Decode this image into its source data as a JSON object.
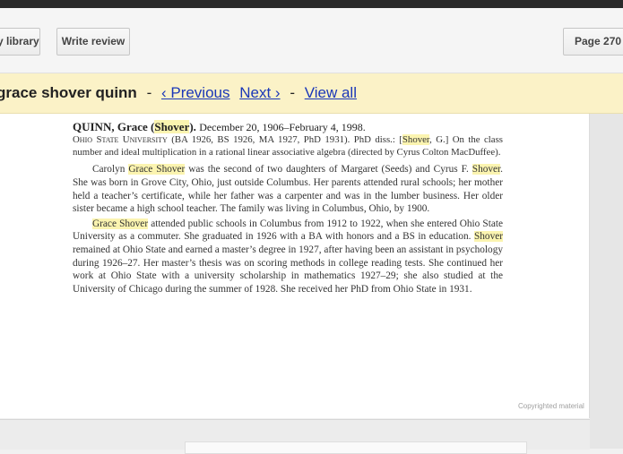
{
  "toolbar": {
    "library_label": "y library",
    "review_label": "Write review",
    "page_label": "Page 270"
  },
  "search": {
    "query": "grace shover quinn",
    "previous": "‹ Previous",
    "next": "Next ›",
    "view_all": "View all",
    "sep": "-"
  },
  "entry": {
    "name": "QUINN, Grace (",
    "name_hl": "Shover",
    "name_end": ").",
    "dates": "December 20, 1906–February 4, 1998.",
    "school": "Ohio State University",
    "degrees": "(BA 1926, BS 1926, MA 1927, PhD 1931). PhD diss.: [",
    "diss_hl": "Shover",
    "diss_rest": ", G.] On the class number and ideal multiplication in a rational linear associative algebra (directed by Cyrus Colton MacDuffee).",
    "p1_a": "Carolyn ",
    "p1_hl1": "Grace Shover",
    "p1_b": " was the second of two daughters of Margaret (Seeds) and Cyrus F. ",
    "p1_hl2": "Shover",
    "p1_c": ". She was born in Grove City, Ohio, just outside Columbus. Her parents attended rural schools; her mother held a teacher’s certificate, while her father was a carpenter and was in the lumber business. Her older sister became a high school teacher. The family was living in Columbus, Ohio, by 1900.",
    "p2_hl1": "Grace Shover",
    "p2_a": " attended public schools in Columbus from 1912 to 1922, when she entered Ohio State University as a commuter. She graduated in 1926 with a BA with honors and a BS in education. ",
    "p2_hl2": "Shover",
    "p2_b": " remained at Ohio State and earned a master’s degree in 1927, after having been an assistant in psychology during 1926–27. Her master’s thesis was on scoring methods in college reading tests. She continued her work at Ohio State with a university scholarship in mathematics 1927–29; she also studied at the University of Chicago during the summer of 1928. She received her PhD from Ohio State in 1931."
  },
  "copyright": "Copyrighted material"
}
